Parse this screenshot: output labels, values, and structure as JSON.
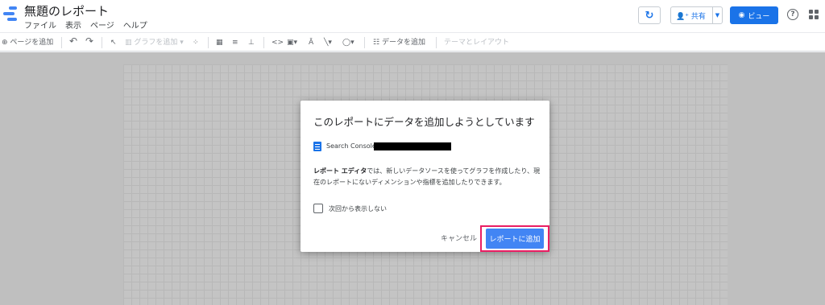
{
  "header": {
    "title": "無題のレポート",
    "menu": [
      "ファイル",
      "表示",
      "ページ",
      "ヘルプ"
    ],
    "share_label": "共有",
    "view_label": "ビュー",
    "help_glyph": "?"
  },
  "toolbar": {
    "add_page": "ページを追加",
    "add_chart": "グラフを追加",
    "add_data": "データを追加",
    "theme_layout": "テーマとレイアウト"
  },
  "dialog": {
    "title": "このレポートにデータを追加しようとしています",
    "datasource_name": "Search Console",
    "description_bold": "レポート エディタ",
    "description_rest": "では、新しいデータソースを使ってグラフを作成したり、現在のレポートにないディメンションや指標を追加したりできます。",
    "checkbox_label": "次回から表示しない",
    "cancel_label": "キャンセル",
    "add_label": "レポートに追加"
  },
  "colors": {
    "accent": "#1a73e8",
    "primary_button": "#4285f4",
    "highlight": "#e91e63"
  }
}
